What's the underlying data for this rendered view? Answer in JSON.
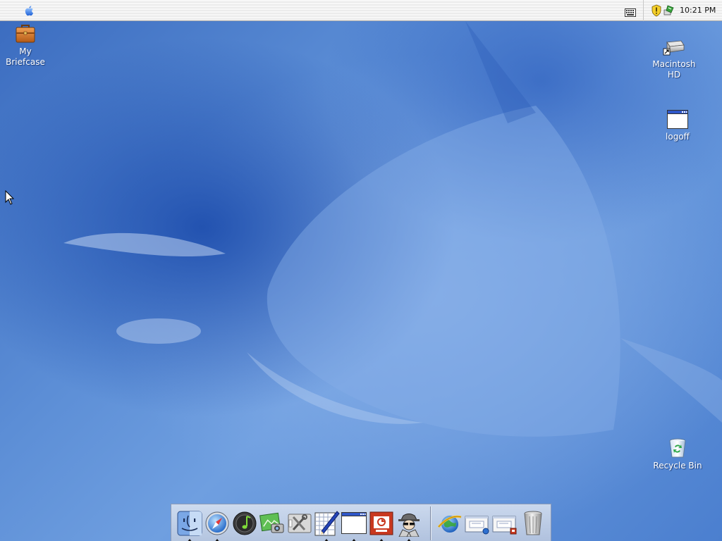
{
  "menubar": {
    "apple_menu_icon": "apple-logo-icon",
    "clock": "10:21 PM",
    "tray_icons": [
      "keyboard-icon",
      "security-shield-icon",
      "network-status-icon"
    ]
  },
  "desktop": {
    "icons": [
      {
        "label": "My\nBriefcase",
        "icon": "briefcase-icon"
      },
      {
        "label": "Macintosh\nHD",
        "icon": "hard-drive-icon"
      },
      {
        "label": "logoff",
        "icon": "window-icon"
      },
      {
        "label": "Recycle Bin",
        "icon": "recycle-bin-icon"
      }
    ]
  },
  "dock": {
    "apps": [
      {
        "icon": "finder-icon",
        "running": true
      },
      {
        "icon": "safari-compass-icon",
        "running": true
      },
      {
        "icon": "itunes-icon",
        "running": false
      },
      {
        "icon": "iphoto-icon",
        "running": false
      },
      {
        "icon": "system-tools-icon",
        "running": false
      },
      {
        "icon": "text-editor-icon",
        "running": true
      },
      {
        "icon": "window-app-icon",
        "running": true
      },
      {
        "icon": "powerpoint-icon",
        "running": true
      },
      {
        "icon": "spy-agent-icon",
        "running": true
      }
    ],
    "docs": [
      {
        "icon": "internet-explorer-icon"
      },
      {
        "icon": "network-window-icon"
      },
      {
        "icon": "presentation-window-icon"
      },
      {
        "icon": "trash-icon"
      }
    ]
  },
  "colors": {
    "wallpaper_base": "#4f82d0",
    "menubar_bg": "#f2f2f2",
    "label_text": "#ffffff"
  }
}
